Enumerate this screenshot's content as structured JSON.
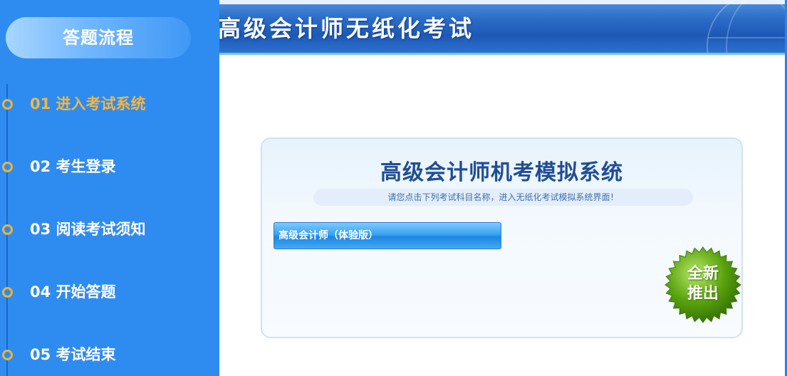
{
  "sidebar": {
    "title": "答题流程",
    "steps": [
      {
        "label": "01 进入考试系统",
        "active": true
      },
      {
        "label": "02 考生登录",
        "active": false
      },
      {
        "label": "03 阅读考试须知",
        "active": false
      },
      {
        "label": "04 开始答题",
        "active": false
      },
      {
        "label": "05 考试结束",
        "active": false
      }
    ]
  },
  "banner": {
    "title": "高级会计师无纸化考试"
  },
  "panel": {
    "title": "高级会计师机考模拟系统",
    "hint": "请您点击下列考试科目名称，进入无纸化考试模拟系统界面！",
    "subject_button": "高级会计师（体验版）",
    "badge": {
      "line1": "全新",
      "line2": "推出"
    }
  },
  "colors": {
    "sidebar_bg": "#2e8cf0",
    "active_step": "#f5b53f",
    "dot_ring": "#f2b232",
    "panel_title": "#1f4d96",
    "badge_green": "#5aa30e"
  }
}
